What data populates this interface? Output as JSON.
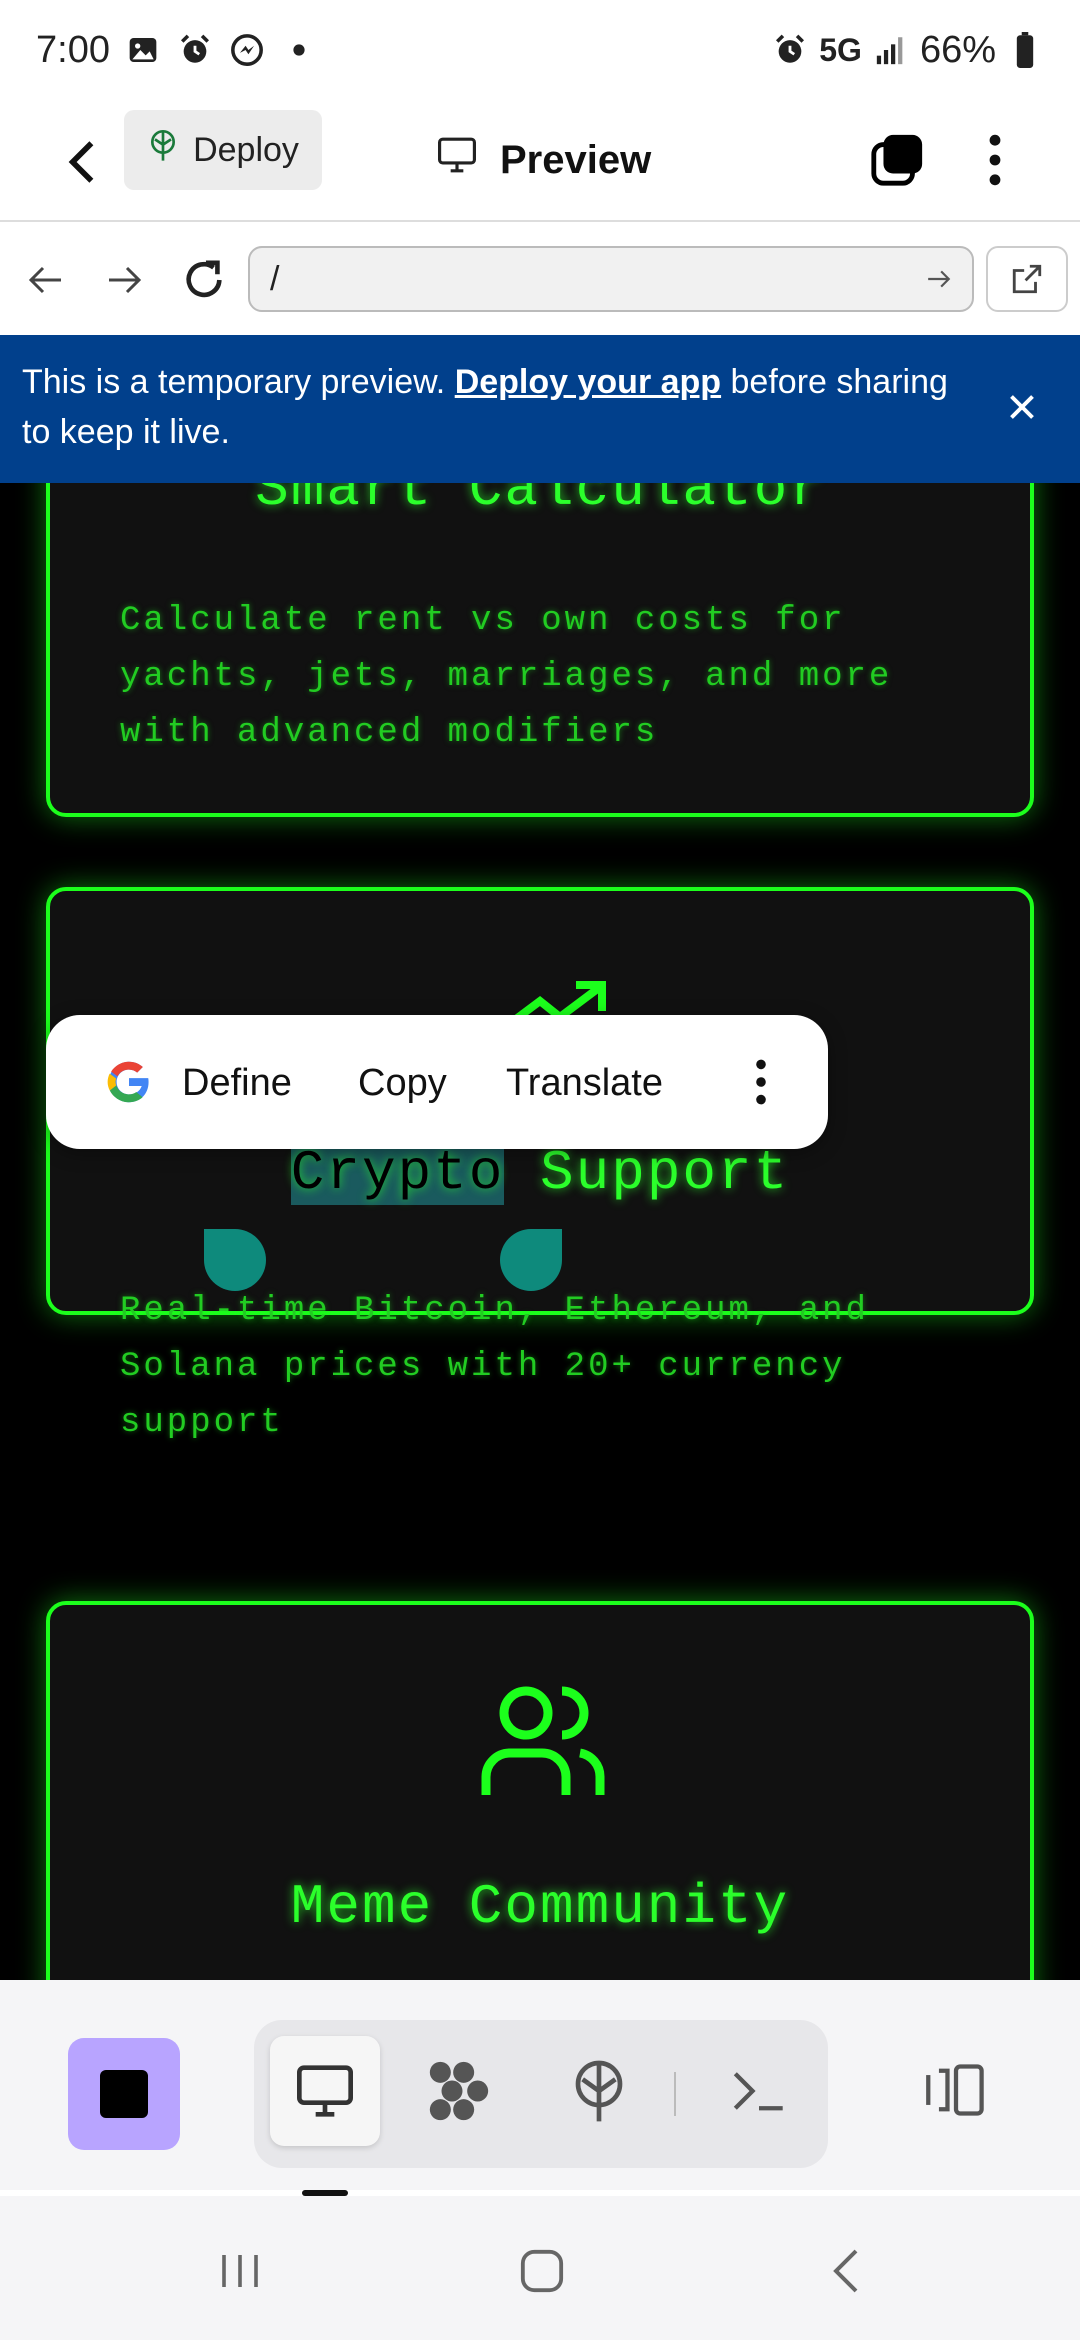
{
  "status_bar": {
    "time": "7:00",
    "network": "5G",
    "battery": "66%",
    "left_icons": [
      "image-icon",
      "alarm-icon",
      "messenger-icon",
      "dot-icon"
    ],
    "right_icons": [
      "alarm-icon",
      "signal-icon",
      "battery-icon"
    ]
  },
  "header": {
    "deploy_label": "Deploy",
    "title": "Preview"
  },
  "url_bar": {
    "value": "/"
  },
  "banner": {
    "text_before": "This is a temporary preview. ",
    "link": "Deploy your app",
    "text_after": " before sharing to keep it live."
  },
  "cards": [
    {
      "title": "Smart Calculator",
      "description": "Calculate rent vs own costs for yachts, jets, marriages, and more with advanced modifiers"
    },
    {
      "title_selected": "Crypto",
      "title_rest": " Support",
      "description": "Real-time Bitcoin, Ethereum, and Solana prices with 20+ currency support",
      "icon": "trending-up-icon"
    },
    {
      "title": "Meme Community",
      "icon": "users-icon"
    }
  ],
  "context_menu": {
    "items": [
      "Define",
      "Copy",
      "Translate"
    ]
  },
  "toolbar": {
    "tools": [
      "desktop-icon",
      "workflow-icon",
      "deploy-icon",
      "terminal-icon"
    ]
  },
  "colors": {
    "accent_green": "#1cff1c",
    "banner_blue": "#01408c",
    "stop_purple": "#b8a4ff"
  }
}
